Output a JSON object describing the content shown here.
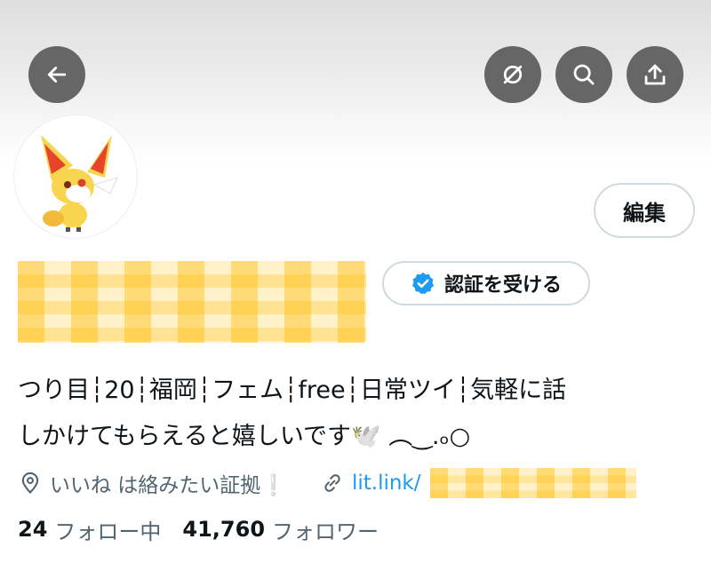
{
  "header": {
    "back_icon": "arrow-left-icon",
    "mute_icon": "circle-slash-icon",
    "search_icon": "search-icon",
    "share_icon": "share-upload-icon"
  },
  "profile": {
    "avatar_icon": "fennekin-avatar",
    "edit_label": "編集",
    "verify_label": "認証を受ける",
    "verify_icon": "verified-badge-icon",
    "bio_line1": "つり目┆20┆福岡┆フェム┆free┆日常ツイ┆気軽に話",
    "bio_line2": "しかけてもらえると嬉しいです🕊️ ︵‿.ₒ○",
    "location": "いいね は絡みたい証拠❕",
    "location_icon": "location-pin-icon",
    "link": "lit.link/",
    "link_icon": "link-icon"
  },
  "stats": {
    "following_count": "24",
    "following_label": "フォロー中",
    "followers_count": "41,760",
    "followers_label": "フォロワー"
  },
  "colors": {
    "link": "#1d9bf0",
    "muted": "#536471",
    "text": "#0f1419",
    "verified": "#1d9bf0"
  }
}
